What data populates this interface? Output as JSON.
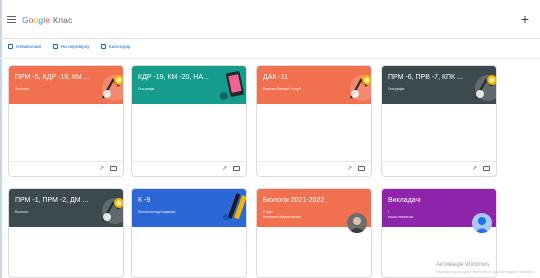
{
  "app": {
    "brand": "Google",
    "product": "Клас"
  },
  "toolbar": {
    "add_label": "+"
  },
  "subnav": {
    "items": [
      {
        "label": "Невиконані",
        "icon": "checklist-icon"
      },
      {
        "label": "На перевірку",
        "icon": "folder-icon"
      },
      {
        "label": "Календар",
        "icon": "calendar-icon"
      }
    ]
  },
  "classes": [
    {
      "title": "ПРМ -5, КДР -19, КМ ...",
      "subtitle": "Зоологія",
      "teacher": "",
      "color": "#f0704f",
      "art": "lamp"
    },
    {
      "title": "КДР -19, КМ -20, НА...",
      "subtitle": "Географія",
      "teacher": "",
      "color": "#159c8c",
      "art": "phone"
    },
    {
      "title": "ДАК -11",
      "subtitle": "Картини Великої Історії",
      "teacher": "",
      "color": "#f0704f",
      "art": "lamp"
    },
    {
      "title": "ПРМ -6, ПРВ -7, КПК ...",
      "subtitle": "Географія",
      "teacher": "",
      "color": "#3c4a50",
      "art": "lamp"
    },
    {
      "title": "ПРМ -1, ПРМ -2, ДМ ...",
      "subtitle": "Біологія",
      "teacher": "",
      "color": "#3c4a50",
      "art": "lamp"
    },
    {
      "title": "К -9",
      "subtitle": "Біологічні підготування",
      "teacher": "",
      "color": "#2c67d8",
      "art": "pen"
    },
    {
      "title": "Біологія 2021-2022",
      "subtitle": "9 курс",
      "teacher": "Катерина Мирончикова",
      "color": "#f0704f",
      "art": "avatar"
    },
    {
      "title": "Викладачі",
      "subtitle": "І",
      "teacher": "наша семінатки",
      "color": "#8e24aa",
      "art": "avatar-blue"
    }
  ],
  "watermark": {
    "title": "Активація Windows",
    "subtitle": "Перейдіть до розділу \"Настройки\", щоб активувати Windows."
  },
  "colors": {
    "accent": "#1967d2",
    "coral": "#f0704f",
    "teal": "#159c8c",
    "slate": "#3c4a50",
    "blue": "#2c67d8",
    "purple": "#8e24aa"
  }
}
